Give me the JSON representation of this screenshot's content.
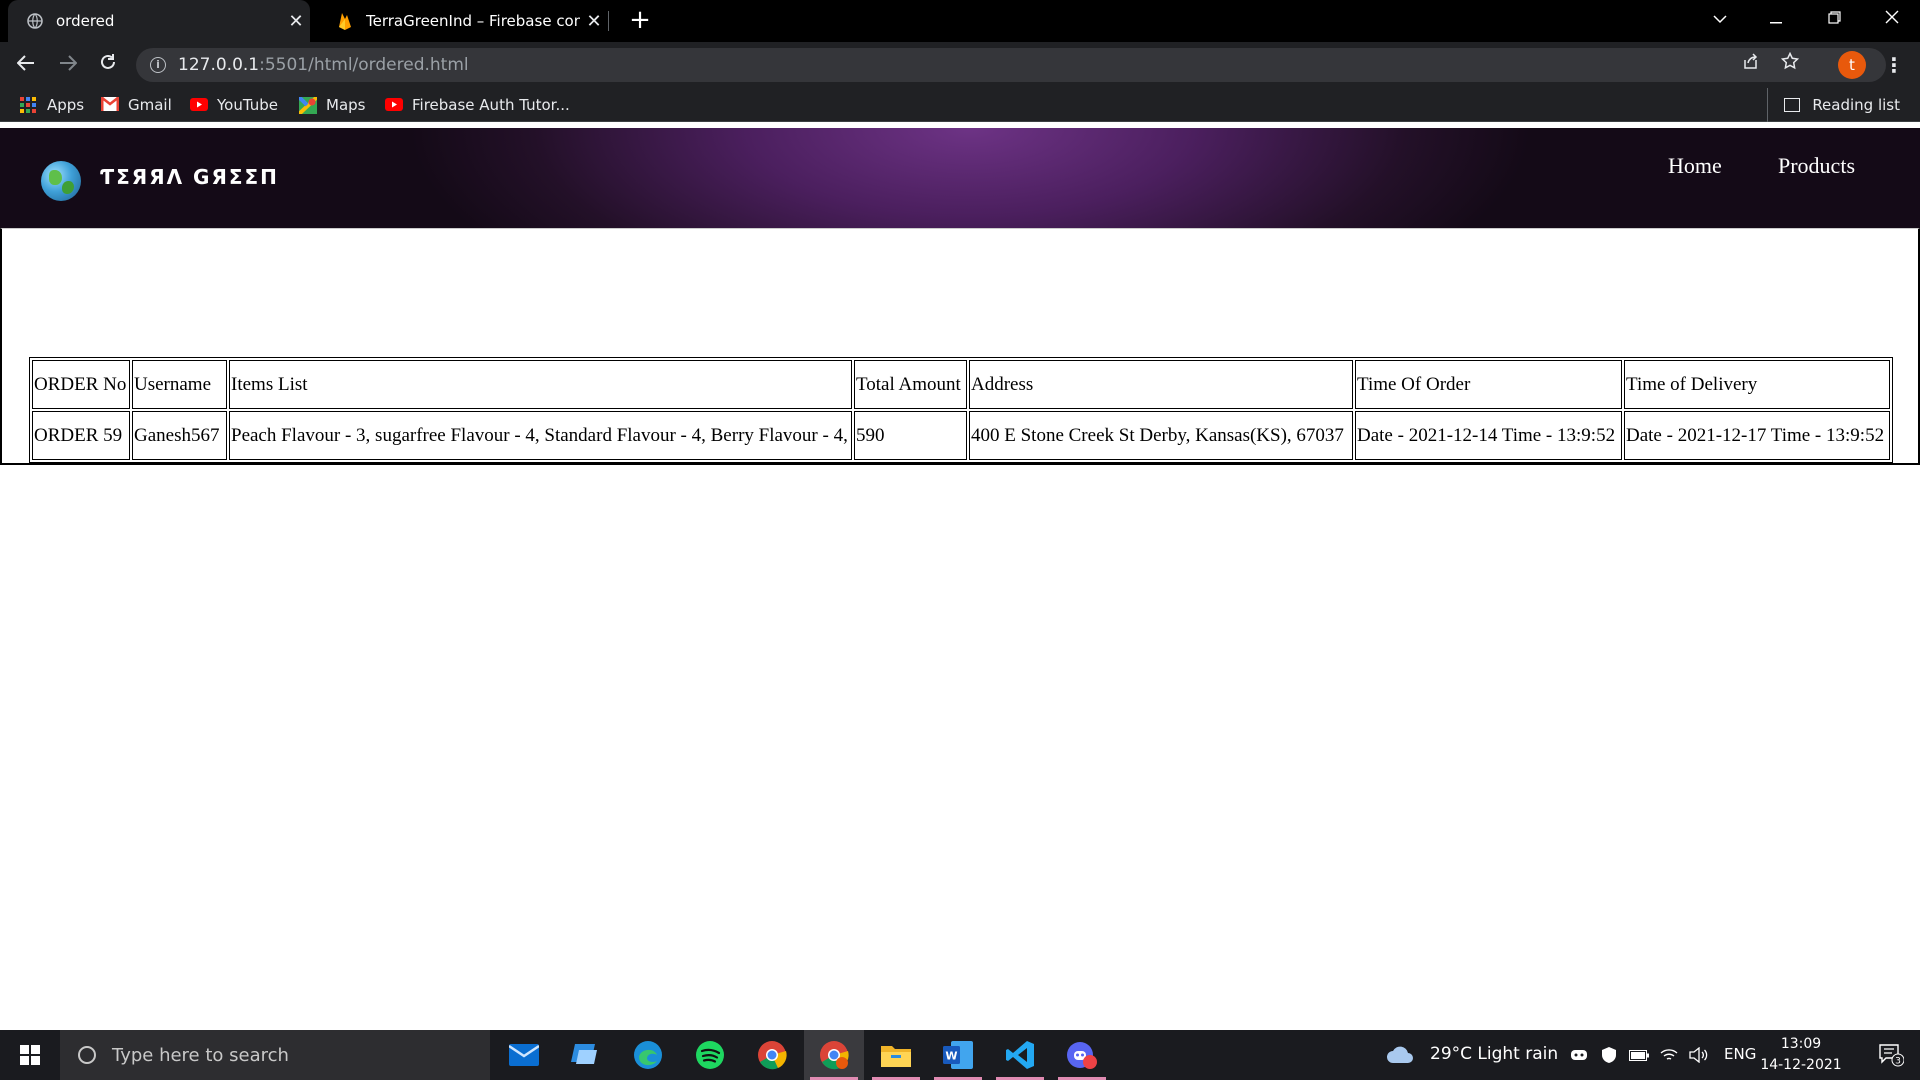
{
  "browser": {
    "tabs": [
      {
        "title": "ordered",
        "favicon": "globe-icon",
        "active": true
      },
      {
        "title": "TerraGreenInd – Firebase console",
        "favicon": "firebase-icon",
        "active": false
      }
    ],
    "close_glyph": "✕",
    "new_tab_glyph": "+",
    "url_host": "127.0.0.1",
    "url_path": ":5501/html/ordered.html",
    "profile_initial": "t",
    "bookmarks": [
      {
        "label": "Apps",
        "icon": "apps-grid-icon"
      },
      {
        "label": "Gmail",
        "icon": "gmail-icon"
      },
      {
        "label": "YouTube",
        "icon": "youtube-icon"
      },
      {
        "label": "Maps",
        "icon": "maps-icon"
      },
      {
        "label": "Firebase Auth Tutor...",
        "icon": "youtube-icon"
      }
    ],
    "reading_list": "Reading list"
  },
  "site": {
    "brand": "ƬΣЯЯΛ GЯΣΣП",
    "nav": {
      "home": "Home",
      "products": "Products"
    }
  },
  "orders_table": {
    "headers": {
      "order_no": "ORDER No",
      "username": "Username",
      "items": "Items List",
      "total": "Total Amount",
      "address": "Address",
      "time_of_order": "Time Of Order",
      "time_of_delivery": "Time of Delivery"
    },
    "rows": [
      {
        "order_no": "ORDER 59",
        "username": "Ganesh567",
        "items": "Peach Flavour - 3, sugarfree Flavour - 4, Standard Flavour - 4, Berry Flavour - 4,",
        "total": "590",
        "address": "400 E Stone Creek St Derby, Kansas(KS), 67037",
        "time_of_order": "Date - 2021-12-14 Time - 13:9:52",
        "time_of_delivery": "Date - 2021-12-17 Time - 13:9:52"
      }
    ]
  },
  "taskbar": {
    "search_placeholder": "Type here to search",
    "weather": "29°C  Light rain",
    "language": "ENG",
    "time": "13:09",
    "date": "14-12-2021",
    "notification_count": "3",
    "chrome_badge": "t",
    "discord_badge": "9+"
  },
  "colors": {
    "header_purple": "#6d3385",
    "browser_dark": "#202124",
    "profile_orange": "#e8590c"
  }
}
